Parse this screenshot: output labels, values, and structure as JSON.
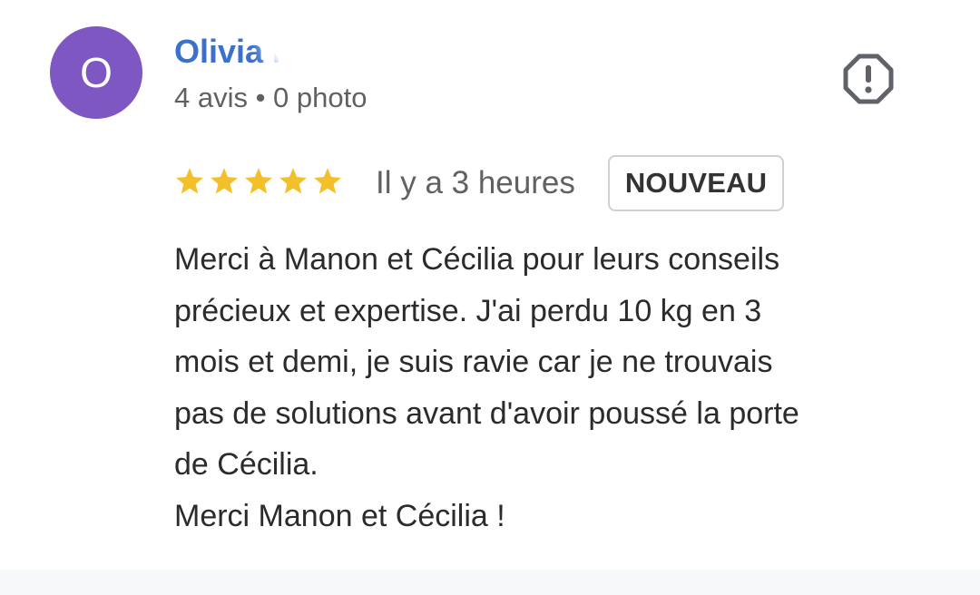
{
  "review": {
    "avatar_initial": "O",
    "avatar_color": "#7e57c2",
    "author_name": "Olivia N",
    "author_meta": "4 avis • 0 photo",
    "rating": 5,
    "rating_max": 5,
    "time_ago": "Il y a 3 heures",
    "badge": "NOUVEAU",
    "text": "Merci à Manon et Cécilia pour leurs conseils\nprécieux et expertise. J'ai perdu 10 kg en 3\nmois et demi, je suis ravie car je ne trouvais\npas de solutions avant d'avoir poussé la porte\nde Cécilia.\nMerci Manon et Cécilia !"
  },
  "icons": {
    "report": "report-flag-icon",
    "star": "star-icon"
  },
  "colors": {
    "name": "#3b71ca",
    "star": "#f4c02a",
    "meta": "#616161",
    "body_text": "#2b2b2b"
  }
}
